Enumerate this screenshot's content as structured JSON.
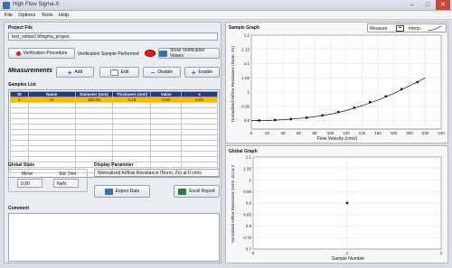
{
  "window": {
    "title": "High Flow Sigma-X"
  },
  "menu": [
    "File",
    "Options",
    "Tools",
    "Help"
  ],
  "project": {
    "label": "Project File",
    "path": "test_online2.hfsigma_project"
  },
  "verification": {
    "procedure_label": "Verification Procedure",
    "performed_label": "Verification Sample Performed",
    "show_values_label": "Show Verification Values"
  },
  "measurements": {
    "title": "Measurements",
    "add": "Add",
    "edit": "Edit",
    "disable": "Disable",
    "enable": "Enable"
  },
  "samples": {
    "title": "Samples List",
    "columns": [
      "ID",
      "Name",
      "Diameter (mm)",
      "Thickness (mm)",
      "Value",
      "±"
    ],
    "rows": [
      {
        "id": "1",
        "name": "s1",
        "diameter": "100,00",
        "thickness": "0,16",
        "value": "0,90",
        "pm": "0,02"
      }
    ]
  },
  "global_stats": {
    "title": "Global Stats",
    "mean_label": "Mean",
    "std_label": "Std. Dev.",
    "mean_value": "0,90",
    "std_value": "NaN"
  },
  "display_param": {
    "title": "Display Parameter",
    "value": "Normalized Airflow Resistance (Norm. Zo) at 0 cm/s"
  },
  "export_label": "Export Data",
  "excel_label": "Excel Report",
  "comment": {
    "title": "Comment"
  },
  "sample_graph": {
    "title": "Sample Graph",
    "measure_label": "Measure",
    "interp_label": "Interp.",
    "ylabel": "Normalized Airflow Resistance (Norm. Zo)",
    "xlabel": "Flow Velocity (cm/s)",
    "xticks": [
      "0",
      "20",
      "40",
      "60",
      "80",
      "100",
      "120",
      "140",
      "160",
      "180",
      "200",
      "220",
      "240"
    ],
    "yticks": [
      "0.9",
      "0.95",
      "1",
      "1.05",
      "1.1",
      "1.15",
      "1.2"
    ]
  },
  "global_graph": {
    "title": "Global Graph",
    "ylabel": "Normalized Airflow Resistance (Norm. Zo) at 0",
    "xlabel": "Sample Number",
    "xticks": [
      "0",
      "1",
      "2"
    ],
    "yticks": [
      "0.7",
      "0.75",
      "0.8",
      "0.85",
      "0.9",
      "0.95",
      "1",
      "1.05",
      "1.1"
    ]
  },
  "chart_data": [
    {
      "type": "line",
      "xlabel": "Flow Velocity (cm/s)",
      "ylabel": "Normalized Airflow Resistance (Norm. Zo)",
      "xlim": [
        0,
        240
      ],
      "ylim": [
        0.87,
        1.2
      ],
      "series": [
        {
          "name": "Measure",
          "x": [
            10,
            30,
            50,
            70,
            90,
            110,
            130,
            150,
            170,
            190,
            210
          ],
          "y": [
            0.9,
            0.902,
            0.905,
            0.91,
            0.918,
            0.93,
            0.945,
            0.965,
            0.985,
            1.01,
            1.035
          ]
        },
        {
          "name": "Interp.",
          "x": [
            0,
            20,
            40,
            60,
            80,
            100,
            120,
            140,
            160,
            180,
            200,
            220
          ],
          "y": [
            0.9,
            0.9,
            0.903,
            0.907,
            0.913,
            0.922,
            0.935,
            0.952,
            0.972,
            0.995,
            1.022,
            1.05
          ]
        }
      ]
    },
    {
      "type": "scatter",
      "xlabel": "Sample Number",
      "ylabel": "Normalized Airflow Resistance (Norm. Zo) at 0",
      "xlim": [
        0,
        2
      ],
      "ylim": [
        0.7,
        1.1
      ],
      "series": [
        {
          "x": [
            1
          ],
          "y": [
            0.9
          ]
        }
      ]
    }
  ]
}
